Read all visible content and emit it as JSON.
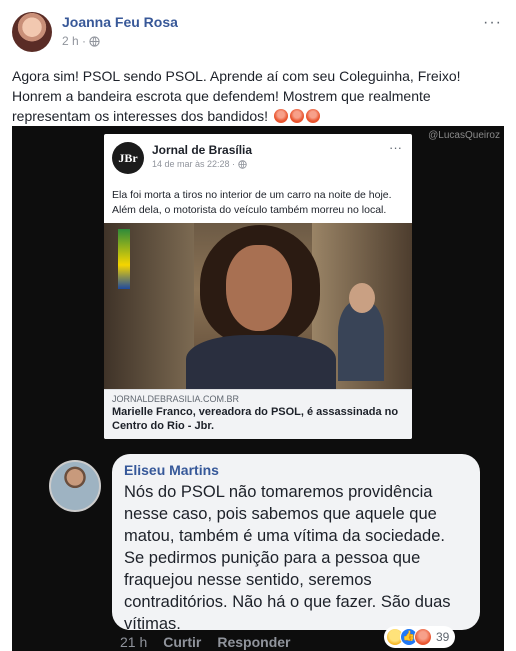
{
  "post": {
    "author": "Joanna Feu Rosa",
    "time": "2 h ·",
    "more": "···",
    "text_line1": "Agora sim! PSOL sendo PSOL. Aprende aí com seu Coleguinha, Freixo!",
    "text_line2": "Honrem a bandeira escrota que defendem! Mostrem que realmente",
    "text_line3": "representam os interesses dos bandidos!"
  },
  "photo": {
    "watermark": "@LucasQueiroz",
    "shared": {
      "logo": "JBr",
      "page": "Jornal de Brasília",
      "date": "14 de mar às 22:28 ·",
      "more": "···",
      "text_line1": "Ela foi morta a tiros no interior de um carro na noite de hoje.",
      "text_line2": "Além dela, o motorista do veículo também morreu no local.",
      "domain": "JORNALDEBRASILIA.COM.BR",
      "title_line1": "Marielle Franco, vereadora do PSOL, é assassinada no",
      "title_line2": "Centro do Rio - Jbr."
    },
    "comment": {
      "author": "Eliseu Martins",
      "line1": "Nós do PSOL não tomaremos providência",
      "line2": "nesse caso, pois sabemos que aquele que",
      "line3": "matou, também é uma vítima da sociedade.",
      "line4": "Se pedirmos punição para a pessoa que",
      "line5": "fraquejou nesse sentido, seremos",
      "line6": "contraditórios. Não há o que fazer. São duas",
      "line7": "vítimas.",
      "time": "21 h",
      "like": "Curtir",
      "reply": "Responder",
      "reaction_count": "39"
    }
  },
  "colors": {
    "link": "#385898",
    "meta": "#90949c",
    "angry": "#e9552f",
    "like": "#2078f4"
  },
  "icons": [
    "globe-icon",
    "more-icon",
    "angry-emoji-icon",
    "haha-reaction-icon",
    "like-reaction-icon",
    "angry-reaction-icon"
  ]
}
